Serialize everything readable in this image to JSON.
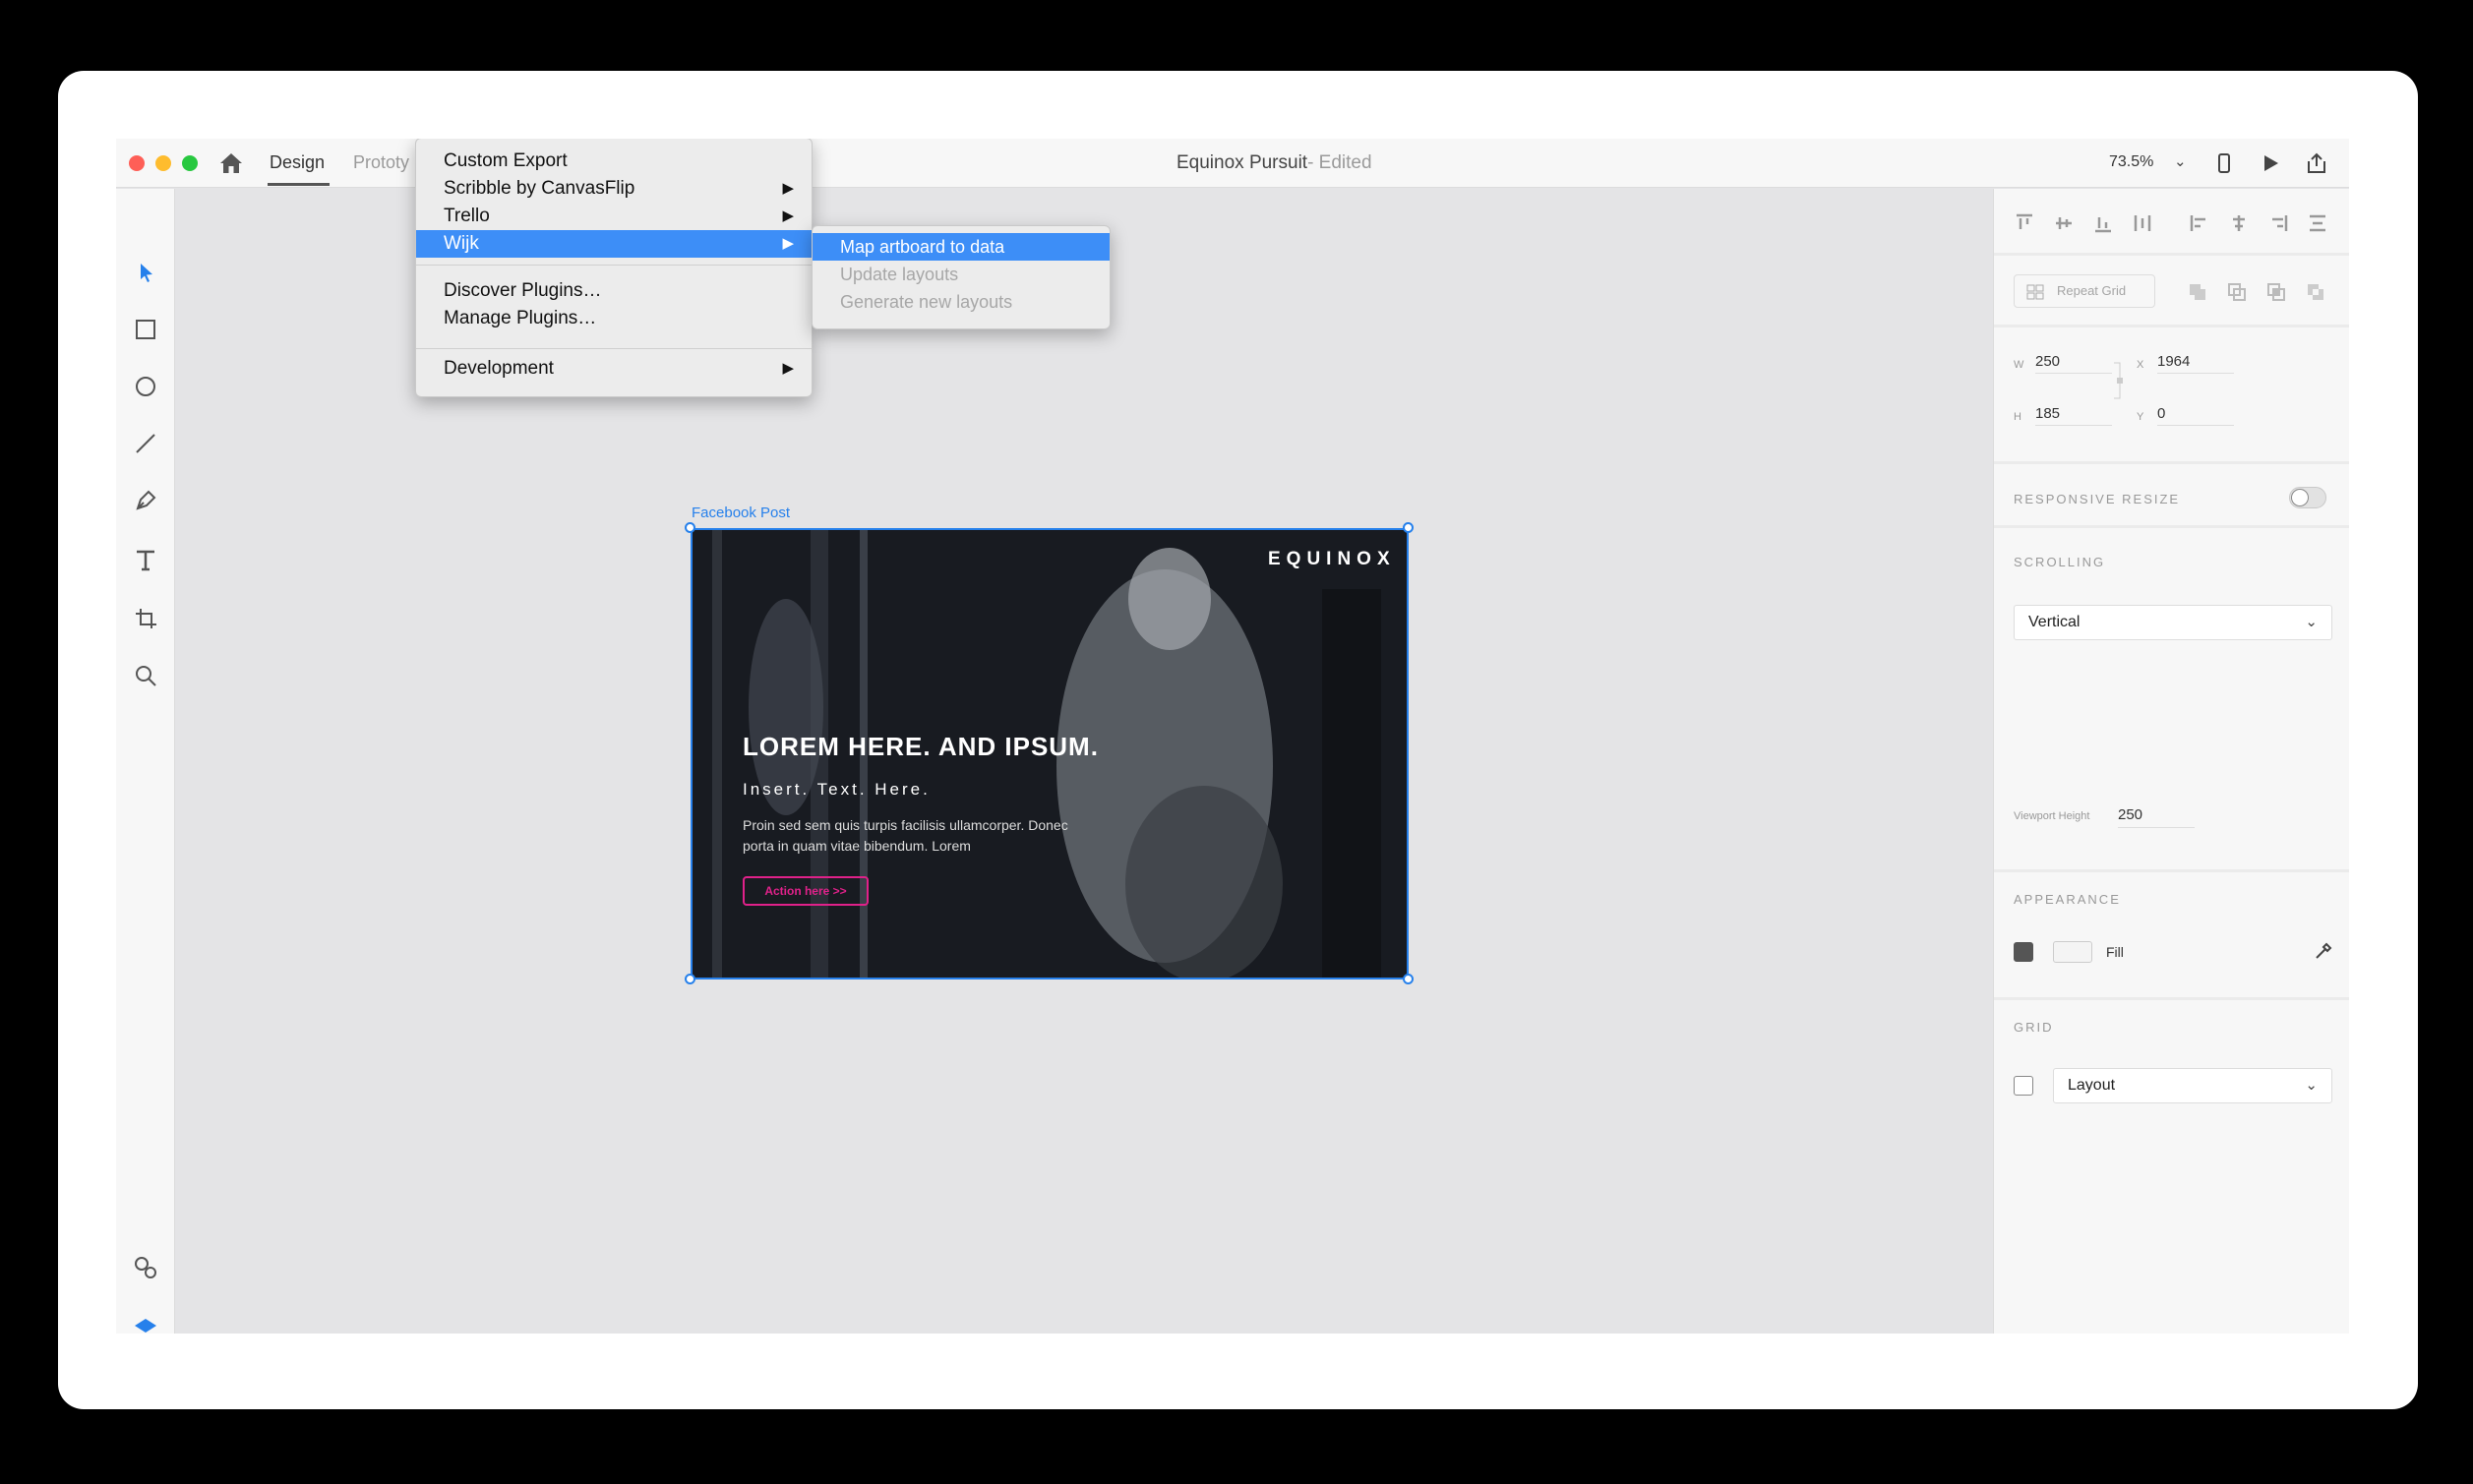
{
  "titlebar": {
    "tabs": [
      "Design",
      "Prototy"
    ],
    "doc_title": "Equinox Pursuit",
    "doc_status": "- Edited",
    "zoom": "73.5%"
  },
  "plugins_menu": {
    "items": [
      {
        "label": "Custom Export"
      },
      {
        "label": "Scribble by CanvasFlip",
        "submenu": true
      },
      {
        "label": "Trello",
        "submenu": true
      },
      {
        "label": "Wijk",
        "submenu": true,
        "selected": true
      },
      {
        "label": "Discover Plugins…"
      },
      {
        "label": "Manage Plugins…"
      },
      {
        "label": "Development",
        "submenu": true
      }
    ],
    "submenu": [
      {
        "label": "Map artboard to data",
        "selected": true
      },
      {
        "label": "Update layouts",
        "disabled": true
      },
      {
        "label": "Generate new layouts",
        "disabled": true
      }
    ],
    "arrow": "▶"
  },
  "artboard": {
    "name": "Facebook Post",
    "brand": "EQUINOX",
    "headline": "LOREM HERE. AND IPSUM.",
    "subhead": "Insert. Text. Here.",
    "body": "Proin sed sem quis turpis facilisis ullamcorper. Donec porta in quam vitae bibendum. Lorem",
    "cta": "Action here >>"
  },
  "panel": {
    "repeat_grid": "Repeat Grid",
    "w_key": "W",
    "w": "250",
    "x_key": "X",
    "x": "1964",
    "h_key": "H",
    "h": "185",
    "y_key": "Y",
    "y": "0",
    "responsive_resize": "RESPONSIVE RESIZE",
    "responsive_on": false,
    "scrolling": "SCROLLING",
    "scrolling_value": "Vertical",
    "viewport_label": "Viewport Height",
    "viewport_value": "250",
    "appearance": "APPEARANCE",
    "fill_label": "Fill",
    "fill_checked": true,
    "grid": "GRID",
    "grid_checked": false,
    "grid_value": "Layout"
  },
  "colors": {
    "accent": "#2680eb",
    "menu_highlight": "#3d8ef7",
    "cta": "#e0218a"
  }
}
